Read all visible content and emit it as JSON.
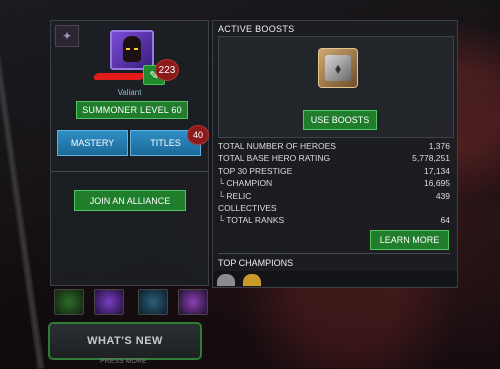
{
  "profile": {
    "subtitle": "Valiant",
    "notification_count": "223",
    "level_label": "SUMMONER LEVEL 60",
    "mastery_label": "MASTERY",
    "titles_label": "TITLES",
    "titles_badge": "40",
    "join_alliance_label": "JOIN AN ALLIANCE"
  },
  "bottom": {
    "whats_new_label": "WHAT'S NEW",
    "press_more": "PRESS MORE"
  },
  "boosts": {
    "title": "ACTIVE BOOSTS",
    "use_label": "USE BOOSTS"
  },
  "stats": [
    {
      "label": "TOTAL NUMBER OF HEROES",
      "value": "1,376"
    },
    {
      "label": "TOTAL BASE HERO RATING",
      "value": "5,778,251"
    },
    {
      "label": "TOP 30 PRESTIGE",
      "value": "17,134"
    },
    {
      "label": "└ CHAMPION",
      "value": "16,695"
    },
    {
      "label": "└ RELIC",
      "value": "439"
    },
    {
      "label": "COLLECTIVES",
      "value": ""
    },
    {
      "label": "└ TOTAL RANKS",
      "value": "64"
    }
  ],
  "learn_more_label": "LEARN MORE",
  "top_champions_label": "TOP CHAMPIONS",
  "colors": {
    "accent_green": "#1f7d2b",
    "accent_blue": "#2f8ec4",
    "badge_red": "#8b1a1a"
  }
}
